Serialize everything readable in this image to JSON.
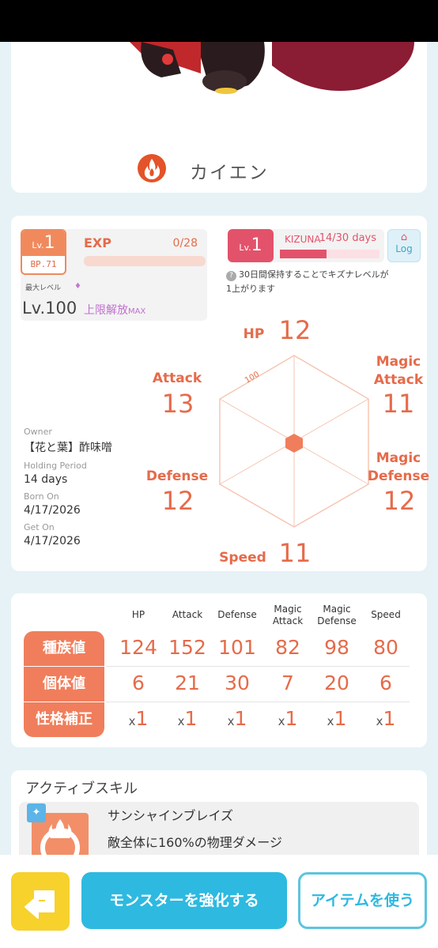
{
  "monster": {
    "name": "カイエン",
    "element_icon": "fire-icon"
  },
  "level": {
    "lv_prefix": "Lv.",
    "lv": "1",
    "bp": "BP.71",
    "exp_label": "EXP",
    "exp_value": "0/28",
    "exp_progress": 0,
    "max_level_label": "最大レベル",
    "max_level": "Lv.100",
    "limit_break": "上限解放",
    "limit_break_suffix": "MAX"
  },
  "kizuna": {
    "lv_prefix": "Lv.",
    "lv": "1",
    "label": "KIZUNA",
    "value": "14/30 days",
    "progress": 0.4667,
    "log_label": "Log",
    "note": "30日間保持することでキズナレベルが1上がります"
  },
  "info": {
    "owner_label": "Owner",
    "owner": "【花と葉】酢味噌",
    "holding_label": "Holding Period",
    "holding": "14 days",
    "born_label": "Born On",
    "born": "4/17/2026",
    "get_label": "Get On",
    "get": "4/17/2026"
  },
  "radar": {
    "scale_label": "100",
    "hp_label": "HP",
    "hp": "12",
    "attack_label": "Attack",
    "attack": "13",
    "magic_attack_label_1": "Magic",
    "magic_attack_label_2": "Attack",
    "magic_attack": "11",
    "defense_label": "Defense",
    "defense": "12",
    "magic_defense_label_1": "Magic",
    "magic_defense_label_2": "Defense",
    "magic_defense": "12",
    "speed_label": "Speed",
    "speed": "11"
  },
  "table": {
    "headers": [
      "HP",
      "Attack",
      "Defense",
      "Magic\nAttack",
      "Magic\nDefense",
      "Speed"
    ],
    "rows": [
      {
        "label": "種族値",
        "values": [
          "124",
          "152",
          "101",
          "82",
          "98",
          "80"
        ]
      },
      {
        "label": "個体値",
        "values": [
          "6",
          "21",
          "30",
          "7",
          "20",
          "6"
        ]
      },
      {
        "label": "性格補正",
        "prefix": "x",
        "values": [
          "1",
          "1",
          "1",
          "1",
          "1",
          "1"
        ]
      }
    ]
  },
  "skill": {
    "section_title": "アクティブスキル",
    "name": "サンシャインブレイズ",
    "description": "敵全体に160%の物理ダメージ"
  },
  "buttons": {
    "enhance": "モンスターを強化する",
    "use_item": "アイテムを使う"
  },
  "colors": {
    "accent_orange": "#e56b4a",
    "kizuna_pink": "#e3526b",
    "primary_blue": "#2eb9e0",
    "back_yellow": "#f7d12c"
  }
}
